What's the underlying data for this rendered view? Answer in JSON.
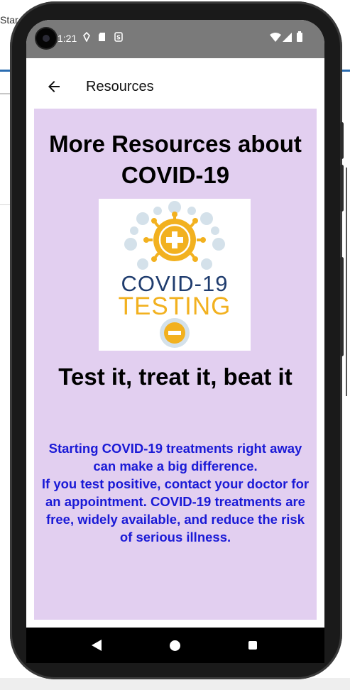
{
  "background": {
    "fragment_text": "Star"
  },
  "status_bar": {
    "time": "1:21",
    "icons": [
      "location-icon",
      "sim-icon",
      "sync-icon",
      "wifi-icon",
      "signal-icon",
      "battery-icon"
    ]
  },
  "app_bar": {
    "title": "Resources",
    "back_icon": "arrow-back-icon"
  },
  "content": {
    "heading": "More Resources about COVID-19",
    "logo": {
      "line1": "COVID-19",
      "line2": "TESTING"
    },
    "tagline": "Test it, treat it, beat it",
    "paragraph_1": "Starting COVID-19 treatments right away can make a big difference.",
    "paragraph_2": "If you test positive, contact your doctor for an appointment. COVID-19 treatments are free, widely available, and reduce the risk of serious illness."
  },
  "nav_bar": {
    "icons": [
      "nav-back-icon",
      "nav-home-icon",
      "nav-recents-icon"
    ]
  },
  "colors": {
    "content_bg": "#e2cff0",
    "body_text": "#1a1ad6",
    "logo_navy": "#1f3c6e",
    "logo_gold": "#f2b11f",
    "logo_light_blue": "#d4e1ea"
  }
}
